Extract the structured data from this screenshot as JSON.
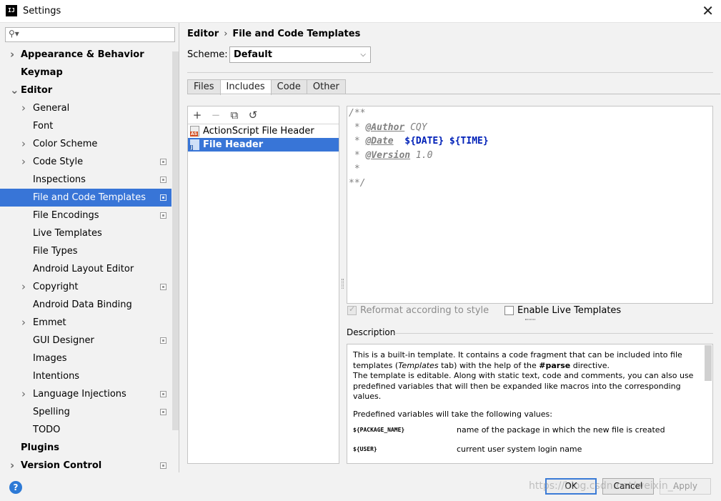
{
  "window": {
    "title": "Settings"
  },
  "search": {
    "placeholder": ""
  },
  "tree": [
    {
      "label": "Appearance & Behavior",
      "level": 0,
      "bold": true,
      "arrow": "right"
    },
    {
      "label": "Keymap",
      "level": 0,
      "bold": true
    },
    {
      "label": "Editor",
      "level": 0,
      "bold": true,
      "arrow": "down"
    },
    {
      "label": "General",
      "level": 1,
      "arrow": "right"
    },
    {
      "label": "Font",
      "level": 1
    },
    {
      "label": "Color Scheme",
      "level": 1,
      "arrow": "right"
    },
    {
      "label": "Code Style",
      "level": 1,
      "arrow": "right",
      "project": true
    },
    {
      "label": "Inspections",
      "level": 1,
      "project": true
    },
    {
      "label": "File and Code Templates",
      "level": 1,
      "project": true,
      "selected": true
    },
    {
      "label": "File Encodings",
      "level": 1,
      "project": true
    },
    {
      "label": "Live Templates",
      "level": 1
    },
    {
      "label": "File Types",
      "level": 1
    },
    {
      "label": "Android Layout Editor",
      "level": 1
    },
    {
      "label": "Copyright",
      "level": 1,
      "arrow": "right",
      "project": true
    },
    {
      "label": "Android Data Binding",
      "level": 1
    },
    {
      "label": "Emmet",
      "level": 1,
      "arrow": "right"
    },
    {
      "label": "GUI Designer",
      "level": 1,
      "project": true
    },
    {
      "label": "Images",
      "level": 1
    },
    {
      "label": "Intentions",
      "level": 1
    },
    {
      "label": "Language Injections",
      "level": 1,
      "arrow": "right",
      "project": true
    },
    {
      "label": "Spelling",
      "level": 1,
      "project": true
    },
    {
      "label": "TODO",
      "level": 1
    },
    {
      "label": "Plugins",
      "level": 0,
      "bold": true
    },
    {
      "label": "Version Control",
      "level": 0,
      "bold": true,
      "arrow": "right",
      "project": true
    }
  ],
  "breadcrumb": {
    "parent": "Editor",
    "separator": "›",
    "current": "File and Code Templates"
  },
  "scheme": {
    "label": "Scheme:",
    "value": "Default"
  },
  "tabs": [
    {
      "label": "Files",
      "active": false
    },
    {
      "label": "Includes",
      "active": true
    },
    {
      "label": "Code",
      "active": false
    },
    {
      "label": "Other",
      "active": false
    }
  ],
  "toolbar": {
    "add": "+",
    "remove": "−",
    "copy": "⧉",
    "reset": "↺"
  },
  "templates": [
    {
      "name": "ActionScript File Header",
      "badge": "AS",
      "selected": false
    },
    {
      "name": "File Header",
      "badge": "J",
      "selected": true
    }
  ],
  "code": {
    "line1": "/**",
    "author_prefix": " * ",
    "author_tag": "@Author",
    "author_value": " CQY",
    "date_prefix": " * ",
    "date_tag": "@Date",
    "date_space": "  ",
    "date_var": "${DATE}",
    "date_sep": " ",
    "time_var": "${TIME}",
    "version_prefix": " * ",
    "version_tag": "@Version",
    "version_value": " 1.0",
    "line5": " *",
    "line6": "**/"
  },
  "options": {
    "reformat": {
      "label": "Reformat according to style",
      "checked": true,
      "enabled": false
    },
    "live": {
      "label": "Enable Live Templates",
      "checked": false
    }
  },
  "description": {
    "label": "Description",
    "p1_a": "This is a built-in template. It contains a code fragment that can be included into file templates (",
    "p1_em": "Templates",
    "p1_b": " tab) with the help of the ",
    "p1_strong": "#parse",
    "p1_c": " directive.",
    "p2": "The template is editable. Along with static text, code and comments, you can also use predefined variables that will then be expanded like macros into the corresponding values.",
    "p3": "Predefined variables will take the following values:",
    "vars": [
      {
        "name": "${PACKAGE_NAME}",
        "desc": "name of the package in which the new file is created"
      },
      {
        "name": "${USER}",
        "desc": "current user system login name"
      }
    ]
  },
  "buttons": {
    "ok": "OK",
    "cancel": "Cancel",
    "apply": "Apply"
  },
  "help": "?",
  "watermark": "https://blog.csdn.net/weixin_..."
}
